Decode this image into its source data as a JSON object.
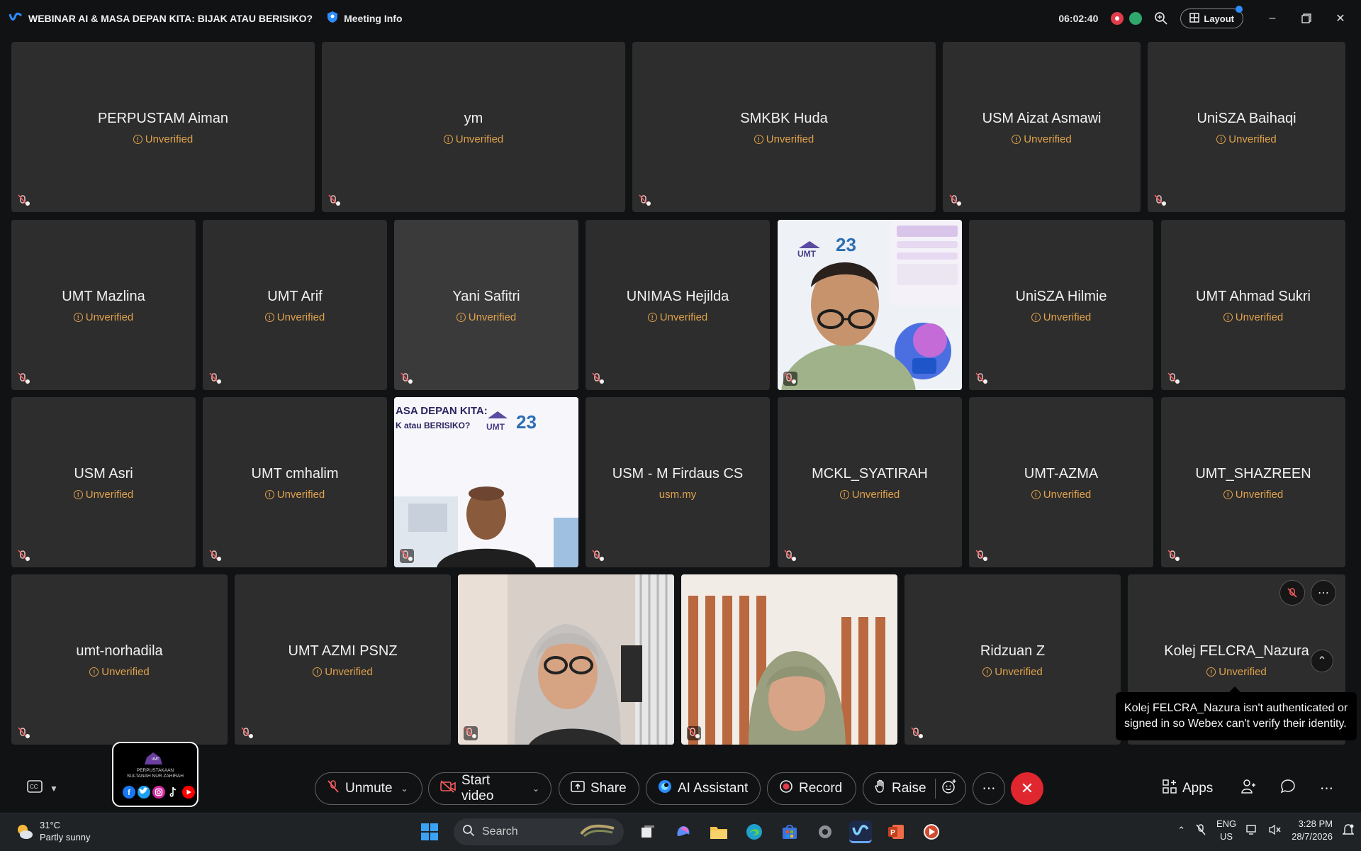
{
  "titlebar": {
    "meeting_title": "WEBINAR AI & MASA DEPAN KITA: BIJAK ATAU BERISIKO?",
    "meeting_info": "Meeting Info",
    "elapsed_time": "06:02:40",
    "layout_label": "Layout"
  },
  "status_label": "Unverified",
  "participants": [
    {
      "name": "PERPUSTAM Aiman",
      "status": "Unverified"
    },
    {
      "name": "ym",
      "status": "Unverified"
    },
    {
      "name": "SMKBK Huda",
      "status": "Unverified"
    },
    {
      "name": "USM Aizat Asmawi",
      "status": "Unverified"
    },
    {
      "name": "UniSZA Baihaqi",
      "status": "Unverified"
    },
    {
      "name": "UMT Mazlina",
      "status": "Unverified"
    },
    {
      "name": "UMT Arif",
      "status": "Unverified"
    },
    {
      "name": "Yani Safitri",
      "status": "Unverified"
    },
    {
      "name": "UNIMAS Hejilda",
      "status": "Unverified"
    },
    {
      "name": "UniSZA Hilmie",
      "status": "Unverified"
    },
    {
      "name": "UMT Ahmad Sukri",
      "status": "Unverified"
    },
    {
      "name": "USM Asri",
      "status": "Unverified"
    },
    {
      "name": "UMT cmhalim",
      "status": "Unverified"
    },
    {
      "name": "USM - M Firdaus CS",
      "status": "usm.my"
    },
    {
      "name": "MCKL_SYATIRAH",
      "status": "Unverified"
    },
    {
      "name": "UMT-AZMA",
      "status": "Unverified"
    },
    {
      "name": "UMT_SHAZREEN",
      "status": "Unverified"
    },
    {
      "name": "umt-norhadila",
      "status": "Unverified"
    },
    {
      "name": "UMT AZMI PSNZ",
      "status": "Unverified"
    },
    {
      "name": "Ridzuan Z",
      "status": "Unverified"
    },
    {
      "name": "Kolej FELCRA_Nazura",
      "status": "Unverified"
    }
  ],
  "video_slide": {
    "text1": "ASA DEPAN KITA:",
    "text2": "K atau BERISIKO?",
    "logo": "UMT",
    "anniv": "23"
  },
  "tooltip": "Kolej FELCRA_Nazura isn't authenticated or signed in so Webex can't verify their identity.",
  "controls": {
    "unmute": "Unmute",
    "start_video": "Start video",
    "share": "Share",
    "ai_assistant": "AI Assistant",
    "record": "Record",
    "raise": "Raise",
    "apps": "Apps"
  },
  "logo_card": {
    "title": "PERPUSTAKAAN",
    "subtitle": "SULTANAH NUR ZAHIRAH",
    "org": "UMT"
  },
  "taskbar": {
    "temperature": "31°C",
    "weather": "Partly sunny",
    "search_placeholder": "Search",
    "lang": "ENG",
    "region": "US",
    "time": "3:28 PM",
    "date": "28/7/2026"
  },
  "colors": {
    "tile_bg": "#2d2d2d",
    "unverified": "#e0a24c",
    "end_call": "#e0262e",
    "accent": "#2d8cff"
  }
}
